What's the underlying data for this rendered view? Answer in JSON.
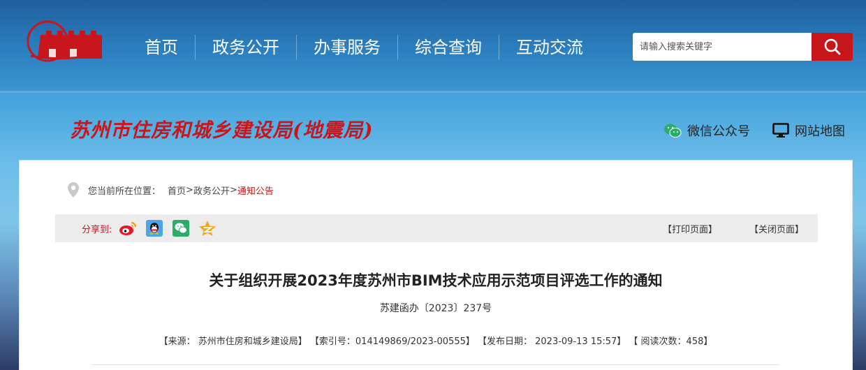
{
  "header": {
    "nav": [
      "首页",
      "政务公开",
      "办事服务",
      "综合查询",
      "互动交流"
    ],
    "search": {
      "placeholder": "请输入搜索关键字"
    },
    "icons": {
      "logo": "city-wall-logo",
      "search": "search-icon"
    },
    "accent": "#c8161d"
  },
  "banner": {
    "site_title": "苏州市住房和城乡建设局(地震局)",
    "links": [
      {
        "label": "微信公众号",
        "icon": "wechat-icon"
      },
      {
        "label": "网站地图",
        "icon": "monitor-icon"
      }
    ]
  },
  "breadcrumb": {
    "label": "您当前所在位置：",
    "items": [
      "首页",
      "政务公开",
      "通知公告"
    ],
    "sep": ">"
  },
  "share": {
    "label": "分享到:",
    "icons": [
      "weibo-icon",
      "qq-icon",
      "wechat-icon",
      "qzone-icon"
    ],
    "print": "【打印页面】",
    "close": "【关闭页面】"
  },
  "article": {
    "title": "关于组织开展2023年度苏州市BIM技术应用示范项目评选工作的通知",
    "doc_no": "苏建函办〔2023〕237号",
    "meta": {
      "source": "【来源： 苏州市住房和城乡建设局】",
      "index": "【索引号：014149869/2023-00555】",
      "date": "【发布日期： 2023-09-13 15:57】",
      "views": "【 阅读次数：458】"
    }
  }
}
